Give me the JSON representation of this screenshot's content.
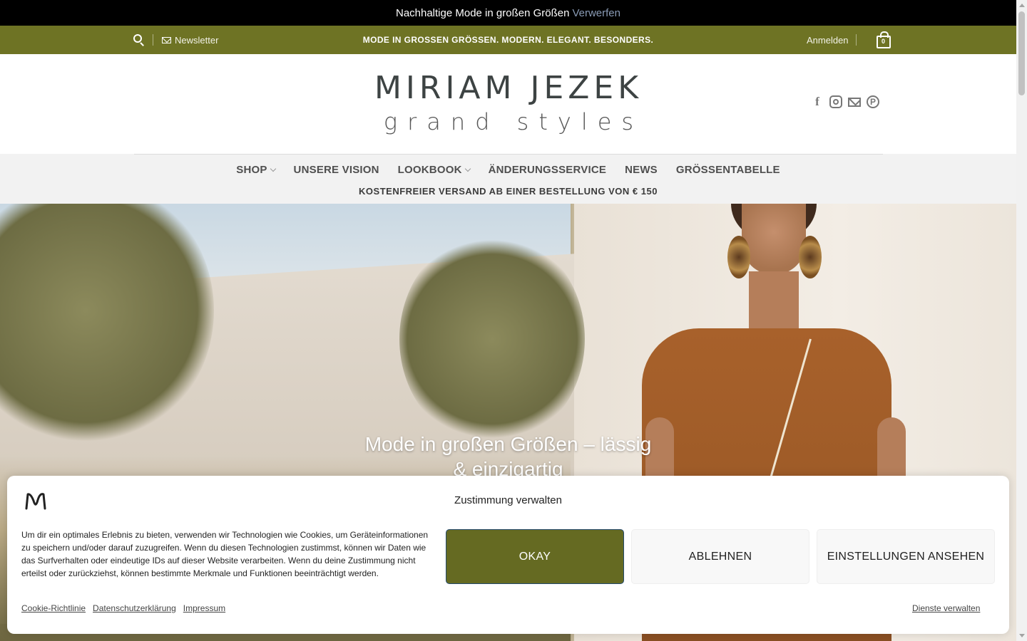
{
  "notice": {
    "text": "Nachhaltige Mode in großen Größen",
    "dismiss": "Verwerfen"
  },
  "topbar": {
    "search_icon": "search-icon",
    "newsletter": "Newsletter",
    "tagline": "MODE IN GROSSEN GRÖSSEN. MODERN. ELEGANT. BESONDERS.",
    "login": "Anmelden",
    "cart_count": "0"
  },
  "logo": {
    "name": "MIRIAM JEZEK",
    "sub": "grand styles"
  },
  "social": [
    "facebook-icon",
    "instagram-icon",
    "email-icon",
    "pinterest-icon"
  ],
  "nav": {
    "items": [
      {
        "label": "SHOP",
        "dropdown": true
      },
      {
        "label": "UNSERE VISION",
        "dropdown": false
      },
      {
        "label": "LOOKBOOK",
        "dropdown": true
      },
      {
        "label": "ÄNDERUNGSSERVICE",
        "dropdown": false
      },
      {
        "label": "NEWS",
        "dropdown": false
      },
      {
        "label": "GRÖSSENTABELLE",
        "dropdown": false
      }
    ],
    "shipping": "KOSTENFREIER VERSAND AB EINER BESTELLUNG VON € 150"
  },
  "hero": {
    "title": "Mode in großen Größen – lässig & einzigartig"
  },
  "cookie": {
    "title": "Zustimmung verwalten",
    "text": "Um dir ein optimales Erlebnis zu bieten, verwenden wir Technologien wie Cookies, um Geräteinformationen zu speichern und/oder darauf zuzugreifen. Wenn du diesen Technologien zustimmst, können wir Daten wie das Surfverhalten oder eindeutige IDs auf dieser Website verarbeiten. Wenn du deine Zustimmung nicht erteilst oder zurückziehst, können bestimmte Merkmale und Funktionen beeinträchtigt werden.",
    "ok": "OKAY",
    "deny": "ABLEHNEN",
    "prefs": "EINSTELLUNGEN ANSEHEN",
    "links": [
      "Cookie-Richtlinie",
      "Datenschutzerklärung",
      "Impressum"
    ],
    "manage": "Dienste verwalten"
  },
  "colors": {
    "accent": "#6e7324",
    "button_ok": "#656a22",
    "notice_bg": "#000000"
  }
}
